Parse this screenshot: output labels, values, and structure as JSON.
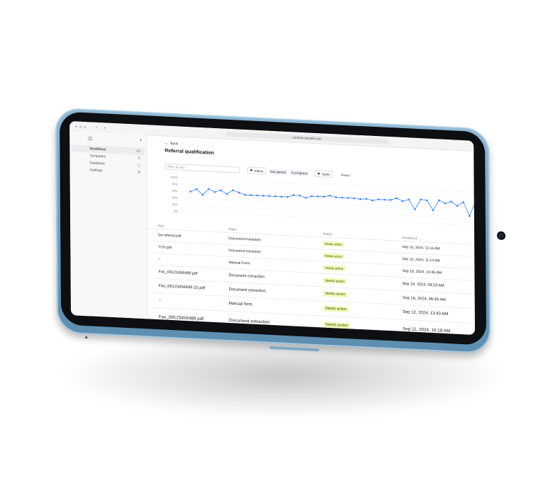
{
  "browser": {
    "url": "console.sample.com"
  },
  "sidebar": {
    "items": [
      {
        "label": "Workflows",
        "icon": "flow-icon",
        "glyph": "Aʏ"
      },
      {
        "label": "Templates",
        "icon": "template-icon",
        "glyph": "☷"
      },
      {
        "label": "Database",
        "icon": "database-icon",
        "glyph": "▢"
      },
      {
        "label": "Settings",
        "icon": "gear-icon",
        "glyph": "⚙"
      }
    ]
  },
  "main": {
    "back_label": "Back",
    "title": "Referral qualification",
    "filter_placeholder": "Filter by key",
    "status_label": "Status",
    "status_chips": [
      "Not started",
      "In progress"
    ],
    "tasks_label": "Tasks",
    "reset_label": "Reset"
  },
  "chart_data": {
    "type": "line",
    "y_ticks": [
      "100%",
      "80%",
      "60%",
      "40%",
      "20%",
      "0%"
    ],
    "ylim": [
      0,
      100
    ],
    "series": [
      {
        "values": [
          60,
          68,
          52,
          70,
          62,
          68,
          58,
          70,
          64,
          58,
          58,
          58,
          58,
          58,
          58,
          58,
          58,
          64,
          64,
          58,
          64,
          64,
          64,
          68,
          64,
          64,
          64,
          64,
          62,
          64,
          60,
          64,
          64,
          64,
          70,
          62,
          68,
          40,
          70,
          68,
          40,
          70,
          62,
          68,
          56,
          68,
          28,
          72
        ],
        "color": "#3b82f6"
      }
    ]
  },
  "table": {
    "headers": [
      "Key",
      "Tasks",
      "Status",
      "Created at"
    ],
    "rows": [
      {
        "key": "bw referral.pdf",
        "task": "Document extraction",
        "status": "Needs action",
        "created": "Sep 16, 2024, 11:16 AM"
      },
      {
        "key": "TCH.pdf",
        "task": "Document extraction",
        "status": "Needs action",
        "created": "Sep 16, 2024, 11:14 AM"
      },
      {
        "key": "–",
        "task": "Manual Form",
        "status": "Needs action",
        "created": "Sep 16, 2024, 10:45 AM"
      },
      {
        "key": "Fax_09123456489.pdf",
        "task": "Document extraction",
        "status": "Needs action",
        "created": "Sep 16, 2024, 08:23 AM"
      },
      {
        "key": "Fax_09123456489 (2).pdf",
        "task": "Document extraction",
        "status": "Needs action",
        "created": "Sep 16, 2024, 06:49 AM"
      },
      {
        "key": "–",
        "task": "Manual form",
        "status": "Needs action",
        "created": "Sep 12, 2024, 13:43 AM"
      },
      {
        "key": "Fax_09123456489.pdf",
        "task": "Document extraction",
        "status": "Needs action",
        "created": "Sep 11, 2024, 16:18 AM"
      }
    ]
  },
  "colors": {
    "badge_bg": "#eefbb5",
    "tablet_body": "#7fa9c6",
    "accent_line": "#3b82f6"
  }
}
